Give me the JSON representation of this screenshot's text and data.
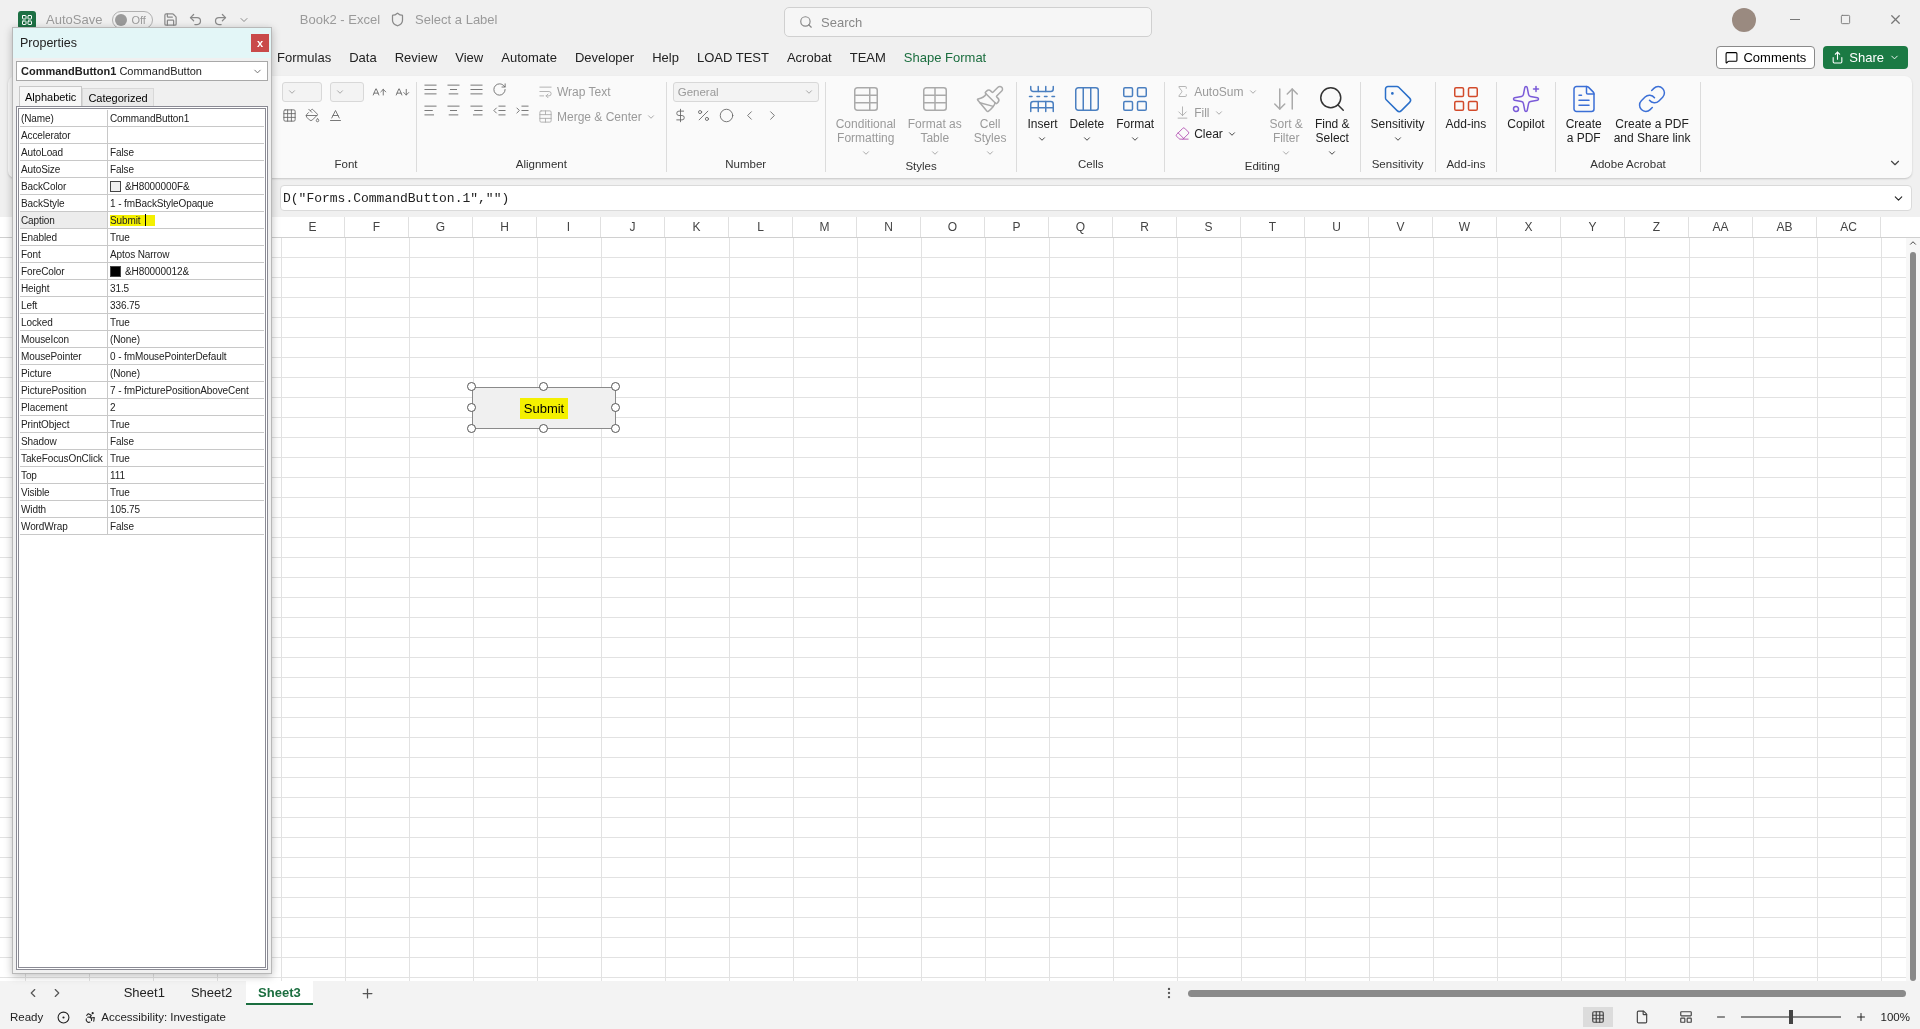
{
  "title_bar": {
    "autosave_label": "AutoSave",
    "autosave_toggle": "Off",
    "autosave_on": false,
    "document_title": "Book2  -  Excel",
    "sensitivity_label": "Select a Label",
    "search_placeholder": "Search"
  },
  "ribbon_tabs": [
    {
      "label": "Formulas",
      "contextual": false
    },
    {
      "label": "Data",
      "contextual": false
    },
    {
      "label": "Review",
      "contextual": false
    },
    {
      "label": "View",
      "contextual": false
    },
    {
      "label": "Automate",
      "contextual": false
    },
    {
      "label": "Developer",
      "contextual": false
    },
    {
      "label": "Help",
      "contextual": false
    },
    {
      "label": "LOAD TEST",
      "contextual": false
    },
    {
      "label": "Acrobat",
      "contextual": false
    },
    {
      "label": "TEAM",
      "contextual": false
    },
    {
      "label": "Shape Format",
      "contextual": true
    }
  ],
  "comments_button": "Comments",
  "share_button": "Share",
  "ribbon_groups": [
    {
      "kind": "font",
      "name": "Font"
    },
    {
      "kind": "alignment",
      "name": "Alignment",
      "commands": [
        {
          "label": "Wrap Text",
          "disabled": true,
          "dropdown": false
        },
        {
          "label": "Merge & Center",
          "disabled": true,
          "dropdown": true
        }
      ]
    },
    {
      "kind": "number",
      "name": "Number",
      "format": "General"
    },
    {
      "kind": "styles",
      "name": "Styles",
      "commands": [
        {
          "label": "Conditional\nFormatting",
          "disabled": true,
          "dropdown": true
        },
        {
          "label": "Format as\nTable",
          "disabled": true,
          "dropdown": true
        },
        {
          "label": "Cell\nStyles",
          "disabled": true,
          "dropdown": true
        }
      ]
    },
    {
      "kind": "cells",
      "name": "Cells",
      "commands": [
        {
          "label": "Insert",
          "disabled": false,
          "dropdown": true
        },
        {
          "label": "Delete",
          "disabled": false,
          "dropdown": true
        },
        {
          "label": "Format",
          "disabled": false,
          "dropdown": true
        }
      ]
    },
    {
      "kind": "editing",
      "name": "Editing",
      "commands": [
        {
          "kind": "small",
          "label": "AutoSum",
          "disabled": true,
          "dropdown": true
        },
        {
          "kind": "small",
          "label": "Fill",
          "disabled": true,
          "dropdown": true
        },
        {
          "kind": "small",
          "label": "Clear",
          "disabled": false,
          "dropdown": true
        },
        {
          "kind": "large",
          "label": "Sort &\nFilter",
          "disabled": true,
          "dropdown": true
        },
        {
          "kind": "large",
          "label": "Find &\nSelect",
          "disabled": false,
          "dropdown": true
        }
      ]
    },
    {
      "kind": "sensitivity",
      "name": "Sensitivity",
      "commands": [
        {
          "label": "Sensitivity",
          "disabled": false,
          "dropdown": true
        }
      ]
    },
    {
      "kind": "addins",
      "name": "Add-ins",
      "commands": [
        {
          "label": "Add-ins",
          "disabled": false,
          "dropdown": false
        }
      ]
    },
    {
      "kind": "copilot",
      "commands": [
        {
          "label": "Copilot",
          "disabled": false,
          "dropdown": false
        }
      ]
    },
    {
      "kind": "acrobat",
      "name": "Adobe Acrobat",
      "commands": [
        {
          "label": "Create\na PDF",
          "disabled": false,
          "dropdown": false
        },
        {
          "label": "Create a PDF\nand Share link",
          "disabled": false,
          "dropdown": false
        }
      ]
    }
  ],
  "formula_bar": {
    "value": "D(\"Forms.CommandButton.1\",\"\")"
  },
  "columns": [
    "E",
    "F",
    "G",
    "H",
    "I",
    "J",
    "K",
    "L",
    "M",
    "N",
    "O",
    "P",
    "Q",
    "R",
    "S",
    "T",
    "U",
    "V",
    "W",
    "X",
    "Y",
    "Z",
    "AA",
    "AB",
    "AC"
  ],
  "embedded_button": {
    "caption": "Submit",
    "highlighted": true,
    "selected": true
  },
  "properties": {
    "title": "Properties",
    "close": "x",
    "object_name": "CommandButton1",
    "object_type": "CommandButton",
    "tabs": [
      {
        "label": "Alphabetic",
        "selected": true
      },
      {
        "label": "Categorized",
        "selected": false
      }
    ],
    "rows": [
      {
        "name": "(Name)",
        "value": "CommandButton1",
        "selected": false
      },
      {
        "name": "Accelerator",
        "selected": false
      },
      {
        "name": "AutoLoad",
        "value": "False",
        "selected": false
      },
      {
        "name": "AutoSize",
        "value": "False",
        "selected": false
      },
      {
        "name": "BackColor",
        "value": "&H8000000F&",
        "color": "#f0f0f0",
        "selected": false
      },
      {
        "name": "BackStyle",
        "value": "1 - fmBackStyleOpaque",
        "selected": false
      },
      {
        "name": "Caption",
        "value": "Submit",
        "selected": true,
        "highlighted": true
      },
      {
        "name": "Enabled",
        "value": "True",
        "selected": false
      },
      {
        "name": "Font",
        "value": "Aptos Narrow",
        "selected": false
      },
      {
        "name": "ForeColor",
        "value": "&H80000012&",
        "color": "#000000",
        "selected": false
      },
      {
        "name": "Height",
        "value": "31.5",
        "selected": false
      },
      {
        "name": "Left",
        "value": "336.75",
        "selected": false
      },
      {
        "name": "Locked",
        "value": "True",
        "selected": false
      },
      {
        "name": "MouseIcon",
        "value": "(None)",
        "selected": false
      },
      {
        "name": "MousePointer",
        "value": "0 - fmMousePointerDefault",
        "selected": false
      },
      {
        "name": "Picture",
        "value": "(None)",
        "selected": false
      },
      {
        "name": "PicturePosition",
        "value": "7 - fmPicturePositionAboveCent",
        "selected": false
      },
      {
        "name": "Placement",
        "value": "2",
        "selected": false
      },
      {
        "name": "PrintObject",
        "value": "True",
        "selected": false
      },
      {
        "name": "Shadow",
        "value": "False",
        "selected": false
      },
      {
        "name": "TakeFocusOnClick",
        "value": "True",
        "selected": false
      },
      {
        "name": "Top",
        "value": "111",
        "selected": false
      },
      {
        "name": "Visible",
        "value": "True",
        "selected": false
      },
      {
        "name": "Width",
        "value": "105.75",
        "selected": false
      },
      {
        "name": "WordWrap",
        "value": "False",
        "selected": false
      }
    ]
  },
  "sheet_tabs": [
    {
      "label": "Sheet1",
      "selected": false
    },
    {
      "label": "Sheet2",
      "selected": false
    },
    {
      "label": "Sheet3",
      "selected": true
    }
  ],
  "status_bar": {
    "mode": "Ready",
    "accessibility": "Accessibility: Investigate",
    "zoom": "100%",
    "zoom_level": {
      "level": 0.5
    }
  }
}
